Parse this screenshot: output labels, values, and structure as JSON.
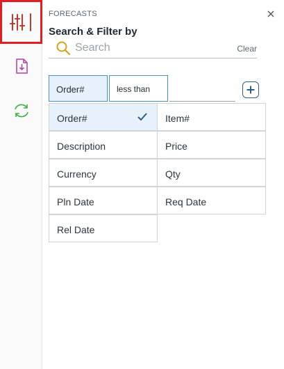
{
  "rail": {
    "items": [
      {
        "icon": "sliders-icon",
        "active": true
      },
      {
        "icon": "file-download-icon",
        "active": false
      },
      {
        "icon": "refresh-icon",
        "active": false
      }
    ]
  },
  "panel": {
    "breadcrumb": "FORECASTS",
    "title": "Search & Filter by",
    "search": {
      "placeholder": "Search",
      "value": "",
      "clear_label": "Clear"
    },
    "filter": {
      "field": "Order#",
      "operator": "less than",
      "value": ""
    },
    "fields": [
      {
        "label": "Order#",
        "selected": true
      },
      {
        "label": "Item#",
        "selected": false
      },
      {
        "label": "Description",
        "selected": false
      },
      {
        "label": "Price",
        "selected": false
      },
      {
        "label": "Currency",
        "selected": false
      },
      {
        "label": "Qty",
        "selected": false
      },
      {
        "label": "Pln Date",
        "selected": false
      },
      {
        "label": "Req Date",
        "selected": false
      },
      {
        "label": "Rel Date",
        "selected": false
      }
    ]
  },
  "colors": {
    "active_border": "#e02020",
    "accent": "#4a90c2",
    "selected_bg": "#e6f1fb"
  }
}
